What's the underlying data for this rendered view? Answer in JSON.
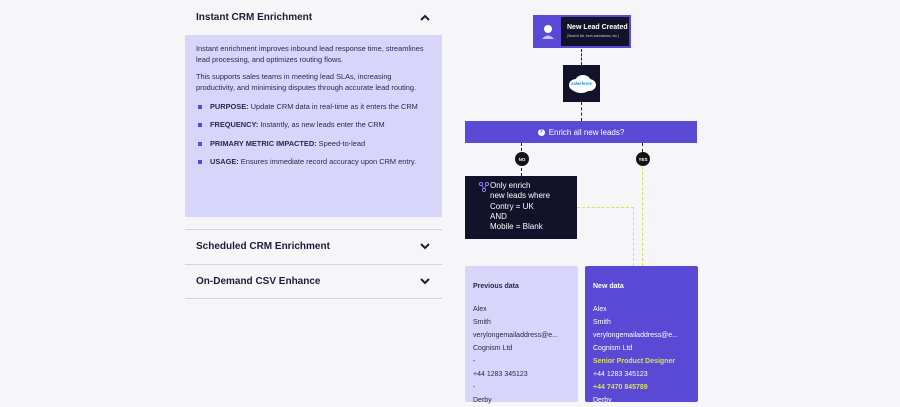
{
  "accordion": {
    "sections": [
      {
        "title": "Instant CRM Enrichment",
        "expanded": true
      },
      {
        "title": "Scheduled CRM Enrichment",
        "expanded": false
      },
      {
        "title": "On-Demand CSV Enhance",
        "expanded": false
      }
    ],
    "panel": {
      "para1": "Instant enrichment improves inbound lead response time, streamlines lead processing, and optimizes routing flows.",
      "para2": "This supports sales teams in meeting lead SLAs, increasing productivity, and minimising disputes through accurate lead routing.",
      "bullets": [
        {
          "label": "PURPOSE:",
          "text": " Update CRM data in real-time as it enters the CRM"
        },
        {
          "label": "FREQUENCY:",
          "text": " Instantly, as new leads enter the CRM"
        },
        {
          "label": "PRIMARY METRIC IMPACTED:",
          "text": " Speed-to-lead"
        },
        {
          "label": "USAGE:",
          "text": " Ensures immediate record accuracy upon CRM entry."
        }
      ]
    }
  },
  "flow": {
    "trigger_title": "New Lead Created",
    "trigger_sub": "(Search list, form submission, etc.)",
    "crm_logo": "salesforce",
    "decision": "Enrich all new leads?",
    "no_label": "NO",
    "yes_label": "YES",
    "condition_lines": [
      "Only enrich",
      "new leads where",
      "Contry = UK",
      "AND",
      "Mobile = Blank"
    ],
    "previous": {
      "title": "Previous data",
      "rows": [
        "Alex",
        "Smith",
        "verylongemailaddress@e...",
        "Cognism Ltd",
        "-",
        "+44 1283 345123",
        "-",
        "Derby"
      ]
    },
    "new": {
      "title": "New data",
      "rows": [
        {
          "text": "Alex",
          "highlight": false
        },
        {
          "text": "Smith",
          "highlight": false
        },
        {
          "text": "verylongemailaddress@e...",
          "highlight": false
        },
        {
          "text": "Cognism Ltd",
          "highlight": false
        },
        {
          "text": "Senior Product Designer",
          "highlight": true
        },
        {
          "text": "+44 1283 345123",
          "highlight": false
        },
        {
          "text": "+44 7470 845789",
          "highlight": true
        },
        {
          "text": "Derby",
          "highlight": false
        }
      ]
    }
  },
  "colors": {
    "accent": "#5a49d4",
    "panel_bg": "#d8d5fb",
    "dark_box": "#12122a",
    "highlight": "#d6e25a"
  },
  "icons": [
    "chevron-up-icon",
    "chevron-down-icon",
    "question-icon",
    "nodes-icon",
    "user-icon",
    "salesforce-logo"
  ]
}
